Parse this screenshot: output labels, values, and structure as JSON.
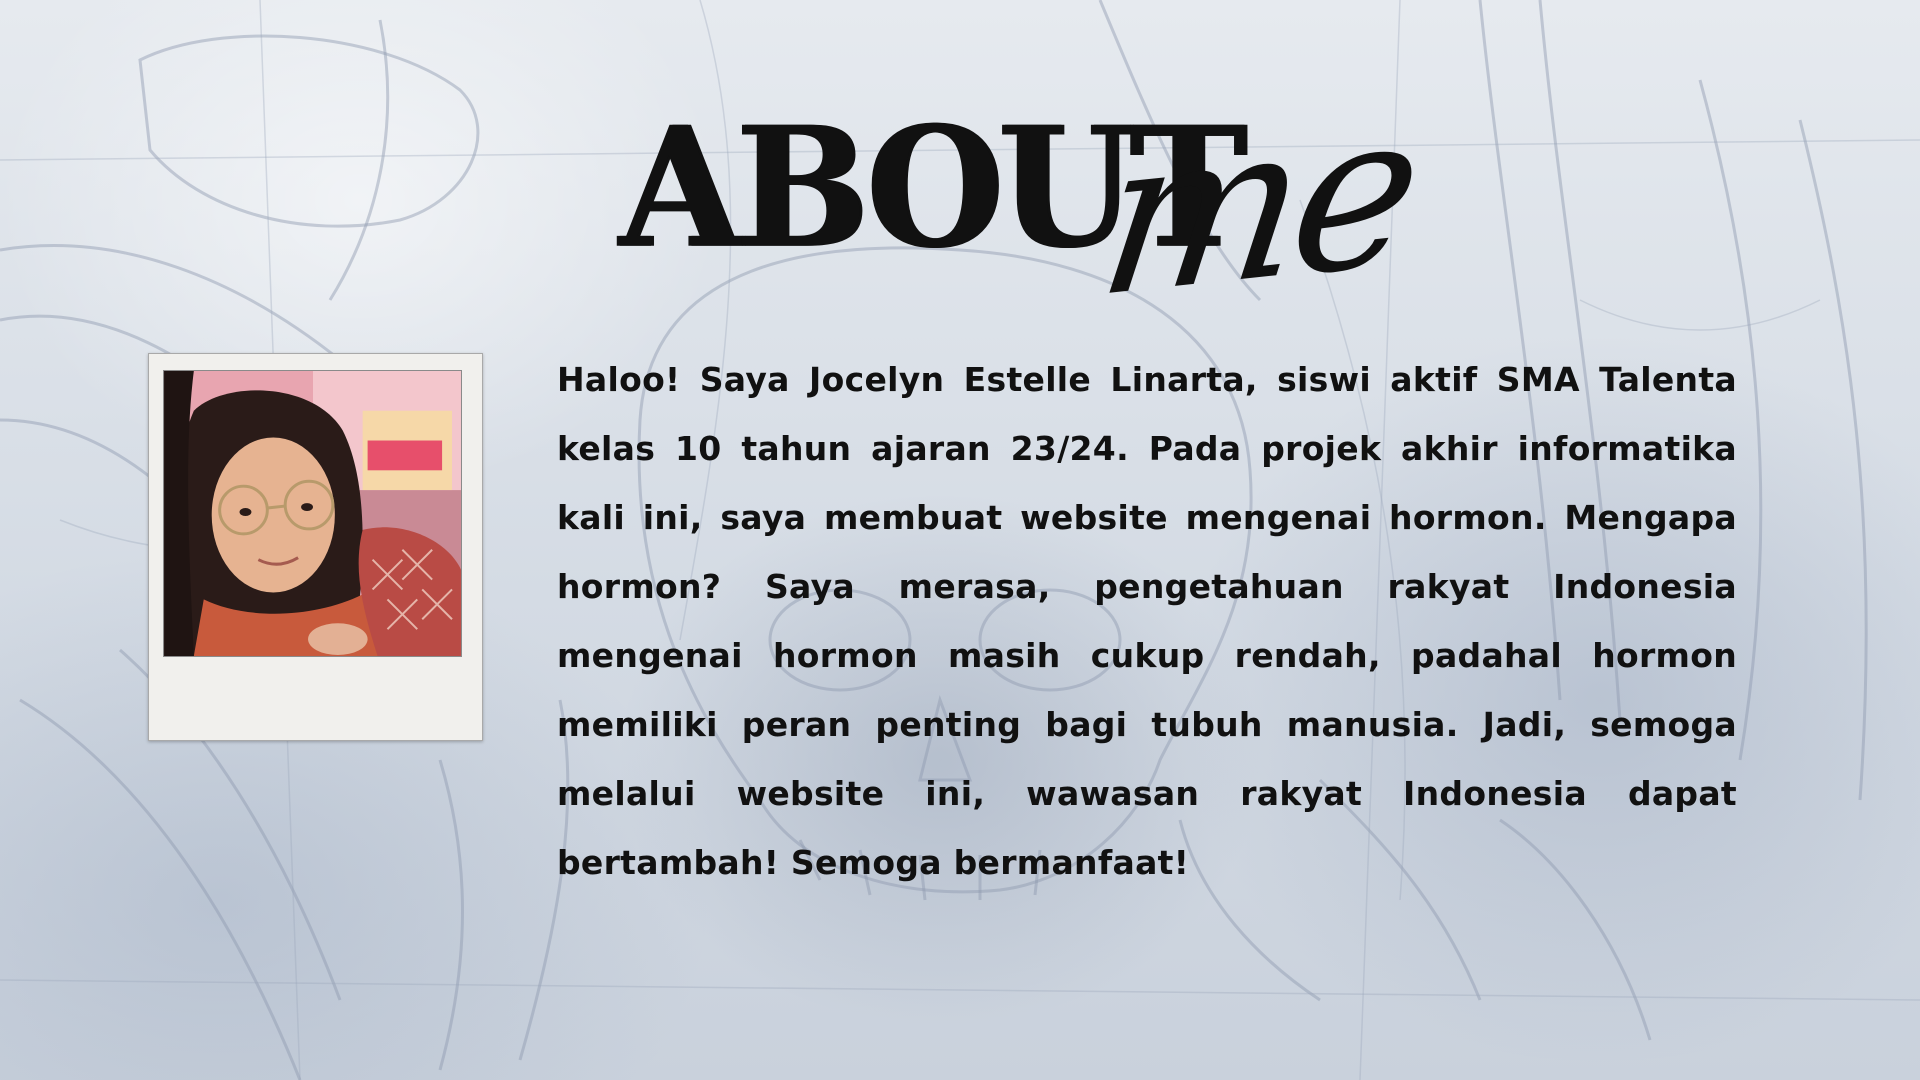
{
  "page": {
    "title_main": "ABOUT",
    "title_script": "me",
    "paragraph": "Haloo! Saya Jocelyn Estelle Linarta, siswi aktif SMA Talenta kelas 10 tahun ajaran 23/24. Pada projek akhir informatika kali ini, saya membuat website mengenai hormon. Mengapa hormon? Saya merasa, pengetahuan rakyat Indonesia mengenai hormon masih cukup rendah, padahal hormon memiliki peran penting bagi tubuh manusia. Jadi, semoga melalui website ini, wawasan rakyat Indonesia dapat bertambah! Semoga bermanfaat!"
  },
  "photo": {
    "icon": "polaroid-photo",
    "frame_color": "#f1f0ed"
  },
  "colors": {
    "text": "#111111",
    "background": "#dde3ea"
  }
}
